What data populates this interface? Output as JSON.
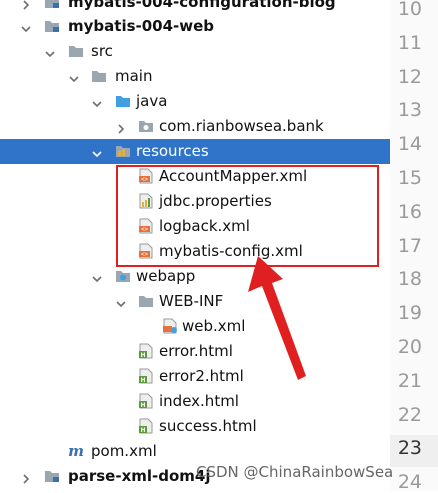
{
  "tree": {
    "rows": [
      {
        "label": "mybatis-004-configuration-blog",
        "icon": "module-folder-icon",
        "arrow": "right",
        "bold": true
      },
      {
        "label": "mybatis-004-web",
        "icon": "module-folder-icon",
        "arrow": "down",
        "bold": true
      },
      {
        "label": "src",
        "icon": "folder-icon",
        "arrow": "down"
      },
      {
        "label": "main",
        "icon": "folder-icon",
        "arrow": "down"
      },
      {
        "label": "java",
        "icon": "source-folder-icon",
        "arrow": "down"
      },
      {
        "label": "com.rianbowsea.bank",
        "icon": "package-icon",
        "arrow": "right"
      },
      {
        "label": "resources",
        "icon": "resources-folder-icon",
        "arrow": "down",
        "selected": true
      },
      {
        "label": "AccountMapper.xml",
        "icon": "xml-file-icon"
      },
      {
        "label": "jdbc.properties",
        "icon": "properties-file-icon"
      },
      {
        "label": "logback.xml",
        "icon": "xml-file-icon"
      },
      {
        "label": "mybatis-config.xml",
        "icon": "xml-file-icon"
      },
      {
        "label": "webapp",
        "icon": "web-folder-icon",
        "arrow": "down"
      },
      {
        "label": "WEB-INF",
        "icon": "folder-icon",
        "arrow": "down"
      },
      {
        "label": "web.xml",
        "icon": "web-xml-file-icon"
      },
      {
        "label": "error.html",
        "icon": "html-file-icon"
      },
      {
        "label": "error2.html",
        "icon": "html-file-icon"
      },
      {
        "label": "index.html",
        "icon": "html-file-icon"
      },
      {
        "label": "success.html",
        "icon": "html-file-icon"
      },
      {
        "label": "pom.xml",
        "icon": "maven-icon"
      },
      {
        "label": "parse-xml-dom4j",
        "icon": "module-folder-icon",
        "arrow": "right",
        "bold": true
      }
    ]
  },
  "gutter": {
    "line_numbers": [
      "10",
      "11",
      "12",
      "13",
      "14",
      "15",
      "16",
      "17",
      "18",
      "19",
      "20",
      "21",
      "22",
      "23",
      "24"
    ],
    "current_line": "23"
  },
  "watermark": "CSDN @ChinaRainbowSea",
  "colors": {
    "selection": "#2f74c8",
    "annotation_red": "#e02020"
  }
}
